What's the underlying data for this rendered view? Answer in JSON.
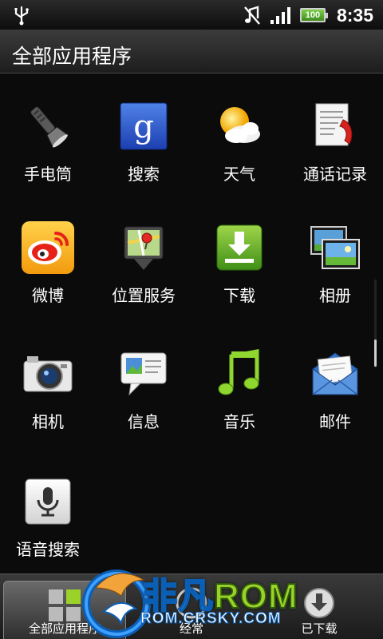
{
  "status_bar": {
    "time": "8:35",
    "battery": "100",
    "icons": [
      "usb-icon",
      "mute-icon",
      "signal-icon",
      "battery-icon"
    ]
  },
  "header": {
    "title": "全部应用程序"
  },
  "apps": [
    {
      "label": "手电筒",
      "icon": "flashlight-icon"
    },
    {
      "label": "搜索",
      "icon": "google-search-icon"
    },
    {
      "label": "天气",
      "icon": "weather-icon"
    },
    {
      "label": "通话记录",
      "icon": "call-log-icon"
    },
    {
      "label": "微博",
      "icon": "weibo-icon"
    },
    {
      "label": "位置服务",
      "icon": "location-icon"
    },
    {
      "label": "下载",
      "icon": "download-icon"
    },
    {
      "label": "相册",
      "icon": "gallery-icon"
    },
    {
      "label": "相机",
      "icon": "camera-icon"
    },
    {
      "label": "信息",
      "icon": "messages-icon"
    },
    {
      "label": "音乐",
      "icon": "music-icon"
    },
    {
      "label": "邮件",
      "icon": "mail-icon"
    },
    {
      "label": "语音搜索",
      "icon": "voice-search-icon"
    }
  ],
  "tabs": [
    {
      "label": "全部应用程序",
      "icon": "all-apps-icon",
      "active": true
    },
    {
      "label": "经常",
      "icon": "frequent-icon",
      "active": false
    },
    {
      "label": "已下载",
      "icon": "downloaded-icon",
      "active": false
    }
  ],
  "watermark": {
    "brand_cn": "非凡",
    "brand_en": "ROM",
    "url": "ROM.CRSKY.COM"
  },
  "colors": {
    "background": "#0b0b0b",
    "text": "#ffffff",
    "battery": "#5cb82e",
    "watermark_blue": "#0a5fb5",
    "watermark_green": "#9bd22a"
  }
}
